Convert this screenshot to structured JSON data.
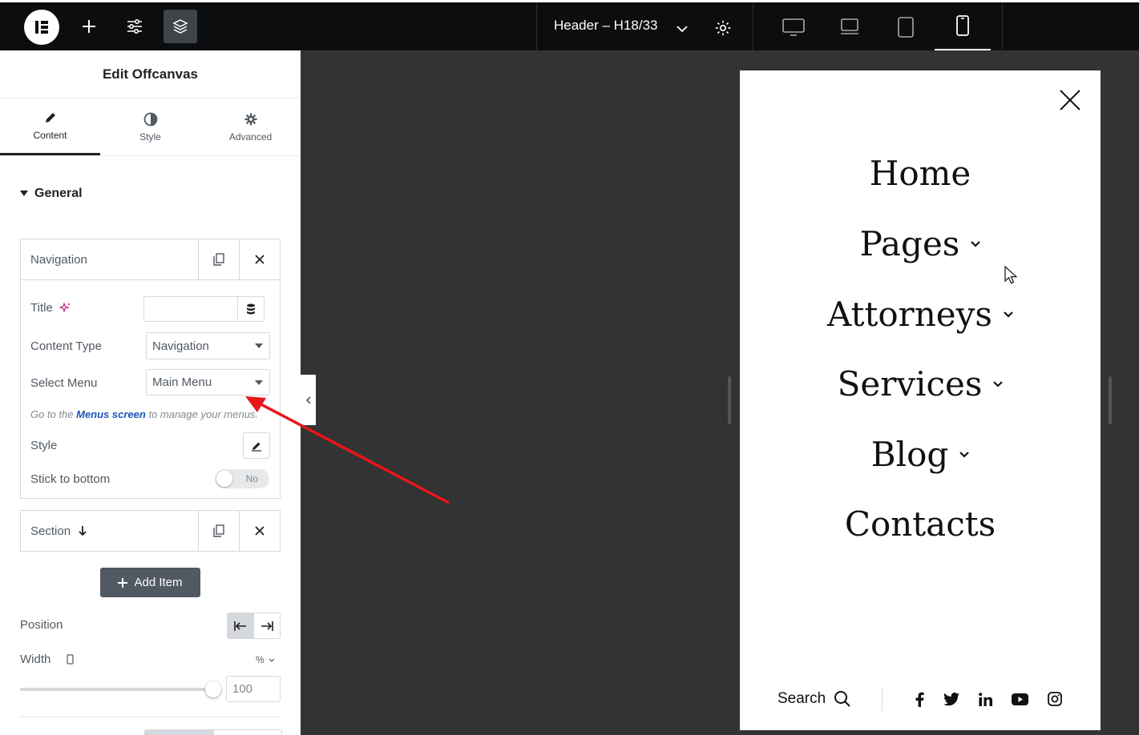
{
  "topbar": {
    "document_title": "Header – H18/33"
  },
  "panel": {
    "title": "Edit Offcanvas",
    "tabs": [
      {
        "label": "Content"
      },
      {
        "label": "Style"
      },
      {
        "label": "Advanced"
      }
    ],
    "section_title": "General",
    "repeater_items": [
      {
        "label": "Navigation"
      },
      {
        "label": "Section"
      }
    ],
    "fields": {
      "title_label": "Title",
      "title_value": "",
      "content_type_label": "Content Type",
      "content_type_value": "Navigation",
      "select_menu_label": "Select Menu",
      "select_menu_value": "Main Menu",
      "hint_prefix": "Go to the",
      "hint_link": "Menus screen",
      "hint_suffix": "to manage your menus.",
      "style_label": "Style",
      "stick_label": "Stick to bottom",
      "stick_value": "No"
    },
    "add_item_label": "Add Item",
    "position_label": "Position",
    "width_label": "Width",
    "width_unit": "%",
    "width_value": "100",
    "width_slider_fraction": 1.0
  },
  "preview": {
    "menu": [
      {
        "label": "Home",
        "has_children": false
      },
      {
        "label": "Pages",
        "has_children": true
      },
      {
        "label": "Attorneys",
        "has_children": true
      },
      {
        "label": "Services",
        "has_children": true
      },
      {
        "label": "Blog",
        "has_children": true
      },
      {
        "label": "Contacts",
        "has_children": false
      }
    ],
    "search_label": "Search",
    "social_icons": [
      "facebook-icon",
      "twitter-icon",
      "linkedin-icon",
      "youtube-icon",
      "instagram-icon"
    ]
  },
  "colors": {
    "annotation_arrow": "#e8161b",
    "link": "#1a56b8",
    "topbar_bg": "#0c0d0e",
    "canvas_bg": "#333333"
  }
}
